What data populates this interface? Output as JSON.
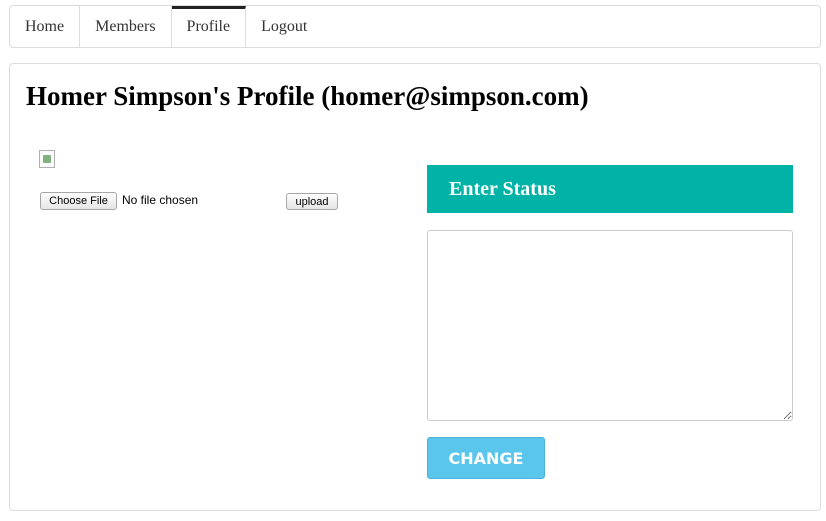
{
  "nav": {
    "items": [
      {
        "label": "Home"
      },
      {
        "label": "Members"
      },
      {
        "label": "Profile",
        "active": true
      },
      {
        "label": "Logout"
      }
    ]
  },
  "profile": {
    "title": "Homer Simpson's Profile (homer@simpson.com)"
  },
  "upload": {
    "choose_label": "Choose File",
    "file_status": "No file chosen",
    "upload_label": "upload"
  },
  "status": {
    "header": "Enter Status",
    "textarea_value": "",
    "change_label": "CHANGE"
  },
  "colors": {
    "status_header_bg": "#00b3a6",
    "change_button_bg": "#5bc6ec"
  }
}
